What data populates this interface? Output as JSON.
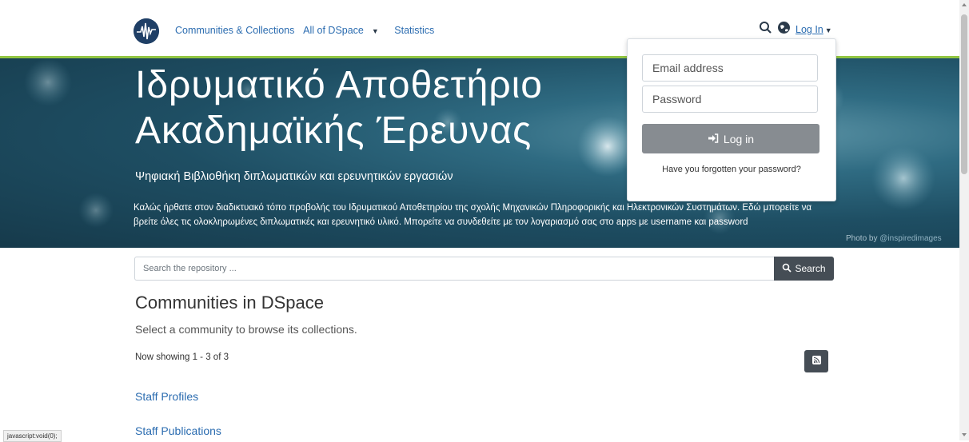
{
  "nav": {
    "items": [
      "Communities & Collections",
      "All of DSpace",
      "Statistics"
    ],
    "login_label": "Log In"
  },
  "banner": {
    "title_line1": "Ιδρυματικό Αποθετήριο",
    "title_line2": "Ακαδημαϊκής Έρευνας",
    "subtitle": "Ψηφιακή Βιβλιοθήκη διπλωματικών και ερευνητικών εργασιών",
    "description": "Καλώς ήρθατε στον διαδικτυακό τόπο προβολής του Ιδρυματικού Αποθετηρίου της σχολής Μηχανικών Πληροφορικής και Ηλεκτρονικών Συστημάτων. Εδώ μπορείτε να βρείτε όλες τις ολοκληρωμένες διπλωματικές και ερευνητικό υλικό. Μπορείτε να συνδεθείτε με τον λογαριασμό σας στο apps με username και password",
    "photo_credit_prefix": "Photo by",
    "photo_credit_handle": "@inspiredimages"
  },
  "login_form": {
    "email_placeholder": "Email address",
    "password_placeholder": "Password",
    "submit_label": "Log in",
    "forgot_label": "Have you forgotten your password?"
  },
  "search": {
    "placeholder": "Search the repository ...",
    "button_label": "Search"
  },
  "main": {
    "title": "Communities in DSpace",
    "subtitle": "Select a community to browse its collections.",
    "showing": "Now showing 1 - 3 of 3",
    "communities": [
      "Staff Profiles",
      "Staff Publications"
    ]
  },
  "status_bar": "javascript:void(0);",
  "colors": {
    "link": "#2b6cb0",
    "accent_line": "#92c642",
    "dark_button": "#454d55",
    "login_button": "#878c91"
  }
}
